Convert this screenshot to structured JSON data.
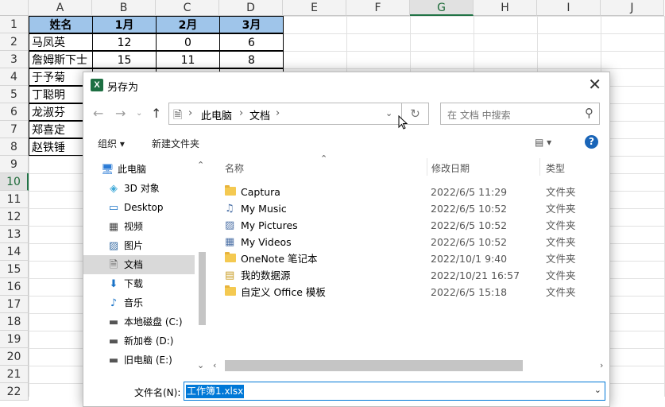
{
  "sheet": {
    "columns": [
      "A",
      "B",
      "C",
      "D",
      "E",
      "F",
      "G",
      "H",
      "I",
      "J"
    ],
    "selected_column": "G",
    "rows": [
      "1",
      "2",
      "3",
      "4",
      "5",
      "6",
      "7",
      "8",
      "9",
      "10",
      "11",
      "12",
      "13",
      "14",
      "15",
      "16",
      "17",
      "18",
      "19",
      "20",
      "21",
      "22"
    ],
    "selected_row": "10",
    "headers": [
      "姓名",
      "1月",
      "2月",
      "3月"
    ],
    "data": [
      [
        "马凤英",
        "12",
        "0",
        "6"
      ],
      [
        "詹姆斯下士",
        "15",
        "11",
        "8"
      ],
      [
        "于予菊",
        "",
        "",
        ""
      ],
      [
        "丁聪明",
        "",
        "",
        ""
      ],
      [
        "龙淑芬",
        "",
        "",
        ""
      ],
      [
        "郑喜定",
        "",
        "",
        ""
      ],
      [
        "赵铁锤",
        "",
        "",
        ""
      ]
    ],
    "colors": {
      "header_fill": "#9fc5ea",
      "select_accent": "#217346"
    }
  },
  "dialog": {
    "title": "另存为",
    "title_icon": "excel-icon",
    "address": {
      "root": "此电脑",
      "folder": "文档"
    },
    "search_placeholder": "在 文档 中搜索",
    "toolbar": {
      "organize": "组织 ▾",
      "new_folder": "新建文件夹",
      "view": "▤ ▾",
      "help": "?"
    },
    "nav": [
      {
        "label": "此电脑",
        "icon": "computer-icon"
      },
      {
        "label": "3D 对象",
        "icon": "cube-icon"
      },
      {
        "label": "Desktop",
        "icon": "desktop-icon"
      },
      {
        "label": "视频",
        "icon": "video-icon"
      },
      {
        "label": "图片",
        "icon": "picture-icon"
      },
      {
        "label": "文档",
        "icon": "document-icon",
        "selected": true
      },
      {
        "label": "下载",
        "icon": "download-icon"
      },
      {
        "label": "音乐",
        "icon": "music-icon"
      },
      {
        "label": "本地磁盘 (C:)",
        "icon": "drive-icon"
      },
      {
        "label": "新加卷 (D:)",
        "icon": "drive-icon"
      },
      {
        "label": "旧电脑 (E:)",
        "icon": "drive-icon"
      }
    ],
    "columns": {
      "name": "名称",
      "date": "修改日期",
      "type": "类型"
    },
    "files": [
      {
        "name": "Captura",
        "date": "2022/6/5 11:29",
        "type": "文件夹",
        "icon": "folder-icon"
      },
      {
        "name": "My Music",
        "date": "2022/6/5 10:52",
        "type": "文件夹",
        "icon": "music-shortcut-icon"
      },
      {
        "name": "My Pictures",
        "date": "2022/6/5 10:52",
        "type": "文件夹",
        "icon": "pictures-shortcut-icon"
      },
      {
        "name": "My Videos",
        "date": "2022/6/5 10:52",
        "type": "文件夹",
        "icon": "videos-shortcut-icon"
      },
      {
        "name": "OneNote 笔记本",
        "date": "2022/10/1 9:40",
        "type": "文件夹",
        "icon": "folder-icon"
      },
      {
        "name": "我的数据源",
        "date": "2022/10/21 16:57",
        "type": "文件夹",
        "icon": "datasource-folder-icon"
      },
      {
        "name": "自定义 Office 模板",
        "date": "2022/6/5 15:18",
        "type": "文件夹",
        "icon": "folder-icon"
      }
    ],
    "filename_label": "文件名(N):",
    "filename_value": "工作簿1.xlsx"
  }
}
